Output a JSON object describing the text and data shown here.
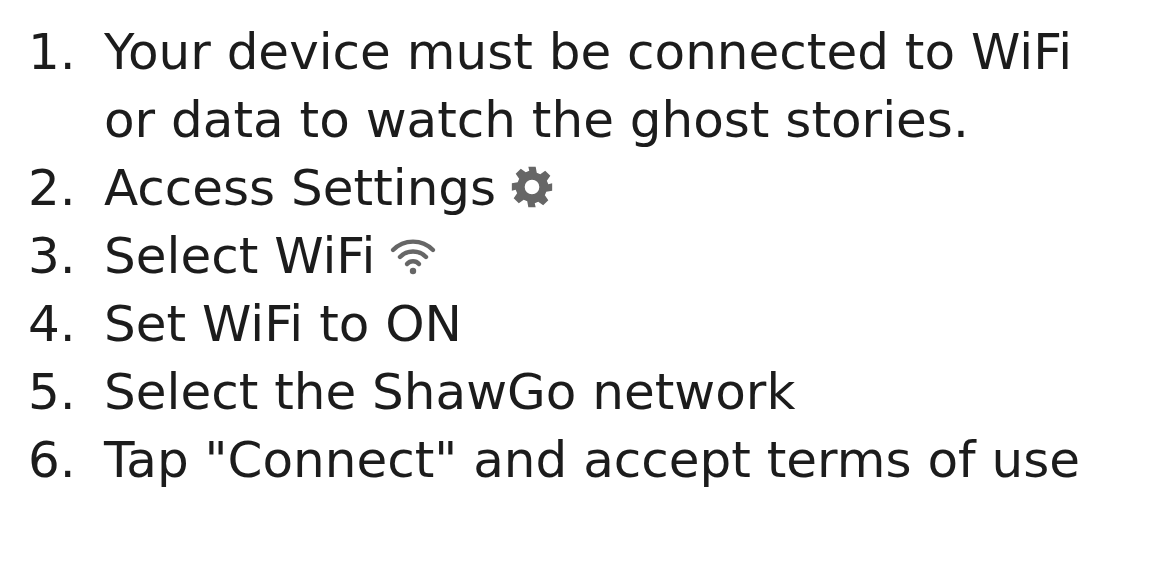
{
  "steps": [
    {
      "number": "1.",
      "text": "Your device must be connected to WiFi or data to watch the ghost stories."
    },
    {
      "number": "2.",
      "text": "Access Settings",
      "kind": "gear"
    },
    {
      "number": "3.",
      "text": "Select WiFi",
      "kind": "wifi"
    },
    {
      "number": "4.",
      "text": "Set WiFi to ON"
    },
    {
      "number": "5.",
      "text": "Select the ShawGo network"
    },
    {
      "number": "6.",
      "text": "Tap \"Connect\" and accept terms of use"
    }
  ]
}
